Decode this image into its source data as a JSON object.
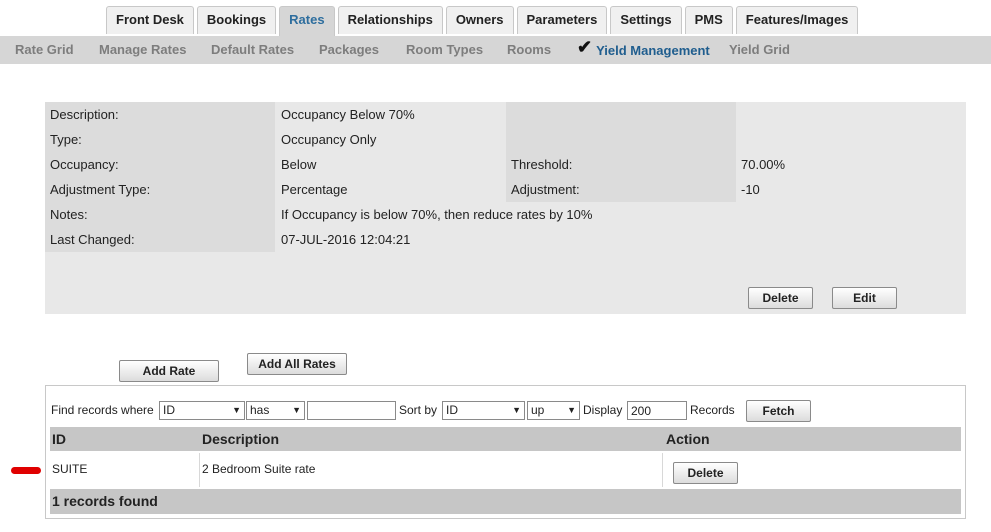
{
  "tabs": [
    "Front Desk",
    "Bookings",
    "Rates",
    "Relationships",
    "Owners",
    "Parameters",
    "Settings",
    "PMS",
    "Features/Images"
  ],
  "active_tab": "Rates",
  "subnav": [
    "Rate Grid",
    "Manage Rates",
    "Default Rates",
    "Packages",
    "Room Types",
    "Rooms",
    "Yield Management",
    "Yield Grid"
  ],
  "active_subnav": "Yield Management",
  "detail": {
    "description_label": "Description:",
    "description_value": "Occupancy Below 70%",
    "type_label": "Type:",
    "type_value": "Occupancy Only",
    "occupancy_label": "Occupancy:",
    "occupancy_value": "Below",
    "threshold_label": "Threshold:",
    "threshold_value": "70.00%",
    "adjustment_type_label": "Adjustment Type:",
    "adjustment_type_value": "Percentage",
    "adjustment_label": "Adjustment:",
    "adjustment_value": "-10",
    "notes_label": "Notes:",
    "notes_value": "If Occupancy is below 70%, then reduce rates by 10%",
    "last_changed_label": "Last Changed:",
    "last_changed_value": "07-JUL-2016 12:04:21",
    "delete_label": "Delete",
    "edit_label": "Edit"
  },
  "actions": {
    "add_rate": "Add Rate",
    "add_all_rates": "Add All Rates"
  },
  "find": {
    "find_label": "Find records where",
    "field_value": "ID",
    "op_value": "has",
    "search_value": "",
    "sort_label": "Sort by",
    "sort_value": "ID",
    "dir_value": "up",
    "display_label": "Display",
    "display_value": "200",
    "records_label": "Records",
    "fetch_label": "Fetch"
  },
  "table": {
    "headers": [
      "ID",
      "Description",
      "Action"
    ],
    "rows": [
      {
        "id": "SUITE",
        "description": "2 Bedroom Suite rate",
        "action": "Delete"
      }
    ],
    "footer": "1 records found"
  },
  "colors": {
    "accent": "#1f5d8e",
    "marker": "#e00000"
  },
  "icons": {
    "active_subnav": "checkmark-icon"
  }
}
